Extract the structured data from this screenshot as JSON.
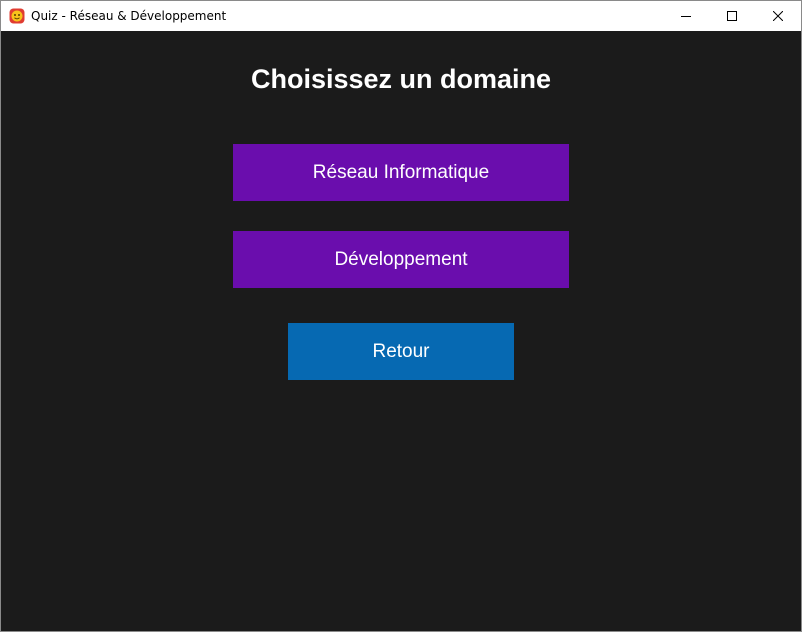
{
  "window": {
    "title": "Quiz - Réseau & Développement",
    "controls": {
      "minimize_icon": "minimize-icon",
      "maximize_icon": "maximize-icon",
      "close_icon": "close-icon"
    }
  },
  "main": {
    "heading": "Choisissez un domaine",
    "buttons": {
      "reseau": "Réseau Informatique",
      "developpement": "Développement",
      "retour": "Retour"
    }
  },
  "colors": {
    "background": "#1b1b1b",
    "domain_button": "#6a0dad",
    "back_button": "#0669b2",
    "text": "#ffffff"
  }
}
